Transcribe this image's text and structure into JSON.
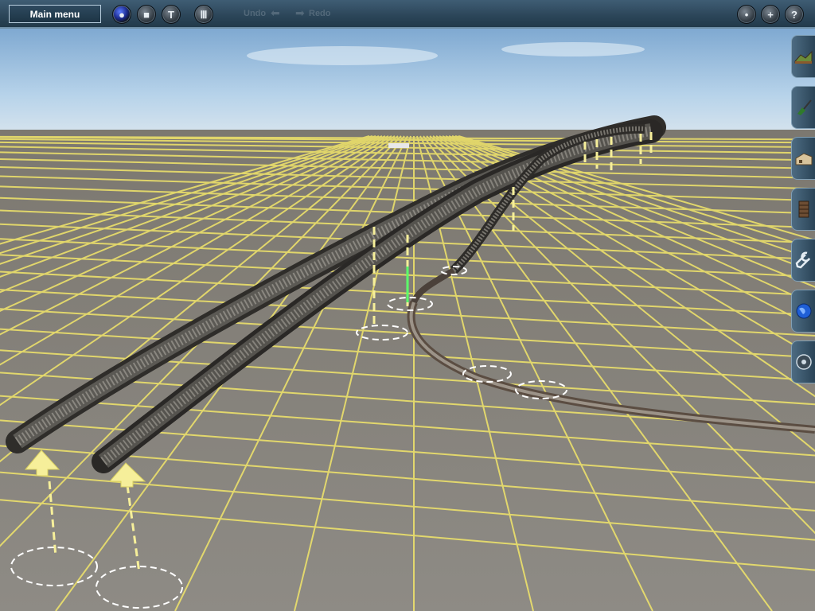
{
  "toolbar": {
    "main_menu_label": "Main menu",
    "undo_label": "Undo",
    "redo_label": "Redo",
    "left_buttons": [
      {
        "icon": "record-icon"
      },
      {
        "icon": "stop-icon"
      },
      {
        "icon": "filter-icon"
      },
      {
        "icon": "grid-icon"
      }
    ],
    "right_buttons": [
      {
        "icon": "mode-icon"
      },
      {
        "icon": "plus-icon",
        "glyph": "+"
      },
      {
        "icon": "help-icon",
        "glyph": "?"
      }
    ]
  },
  "side_tabs": [
    {
      "icon": "terrain-icon"
    },
    {
      "icon": "paint-icon"
    },
    {
      "icon": "building-icon"
    },
    {
      "icon": "track-icon"
    },
    {
      "icon": "tools-icon"
    },
    {
      "icon": "globe-icon"
    },
    {
      "icon": "settings-icon"
    }
  ],
  "colors": {
    "grid": "#f2e66a",
    "ground": "#8c8983",
    "toolbar": "#2b4558",
    "sky": "#a9cde8"
  }
}
